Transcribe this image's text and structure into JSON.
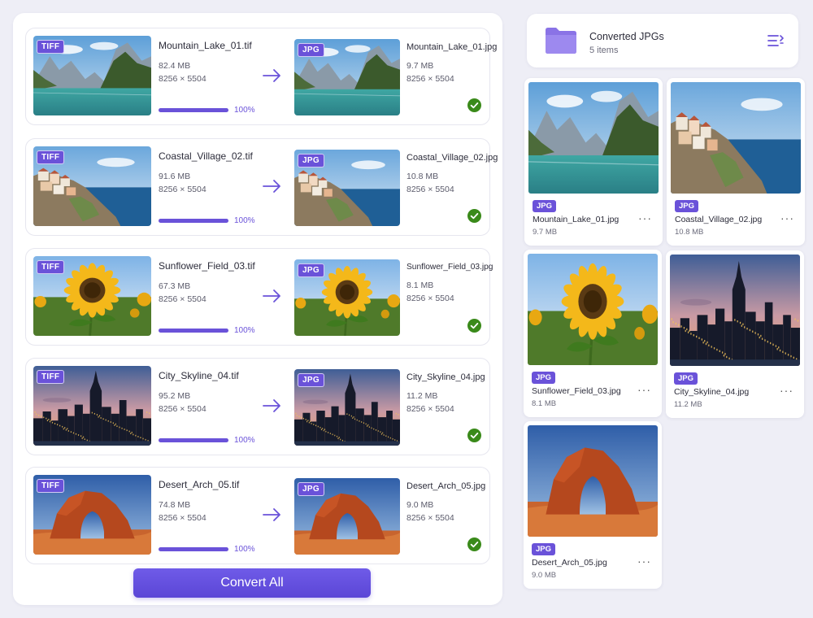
{
  "conversion_list": [
    {
      "src_badge": "TIFF",
      "src_name": "Mountain_Lake_01.tif",
      "src_size": "82.4 MB",
      "src_dims": "8256 × 5504",
      "progress": 100,
      "progress_label": "100%",
      "out_badge": "JPG",
      "out_name": "Mountain_Lake_01.jpg",
      "out_size": "9.7 MB",
      "out_dims": "8256 × 5504",
      "image": "mountain-lake"
    },
    {
      "src_badge": "TIFF",
      "src_name": "Coastal_Village_02.tif",
      "src_size": "91.6 MB",
      "src_dims": "8256 × 5504",
      "progress": 100,
      "progress_label": "100%",
      "out_badge": "JPG",
      "out_name": "Coastal_Village_02.jpg",
      "out_size": "10.8 MB",
      "out_dims": "8256 × 5504",
      "image": "coastal-village"
    },
    {
      "src_badge": "TIFF",
      "src_name": "Sunflower_Field_03.tif",
      "src_size": "67.3 MB",
      "src_dims": "8256 × 5504",
      "progress": 100,
      "progress_label": "100%",
      "out_badge": "JPG",
      "out_name": "Sunflower_Field_03.jpg",
      "out_size": "8.1 MB",
      "out_dims": "8256 × 5504",
      "image": "sunflower"
    },
    {
      "src_badge": "TIFF",
      "src_name": "City_Skyline_04.tif",
      "src_size": "95.2 MB",
      "src_dims": "8256 × 5504",
      "progress": 100,
      "progress_label": "100%",
      "out_badge": "JPG",
      "out_name": "City_Skyline_04.jpg",
      "out_size": "11.2 MB",
      "out_dims": "8256 × 5504",
      "image": "city-skyline"
    },
    {
      "src_badge": "TIFF",
      "src_name": "Desert_Arch_05.tif",
      "src_size": "74.8 MB",
      "src_dims": "8256 × 5504",
      "progress": 100,
      "progress_label": "100%",
      "out_badge": "JPG",
      "out_name": "Desert_Arch_05.jpg",
      "out_size": "9.0 MB",
      "out_dims": "8256 × 5504",
      "image": "desert-arch"
    }
  ],
  "convert_button_label": "Convert All",
  "folder": {
    "title": "Converted JPGs",
    "count": "5 items",
    "icon": "folder-icon",
    "view_icon": "list-view-icon"
  },
  "gallery": [
    {
      "badge": "JPG",
      "name": "Mountain_Lake_01.jpg",
      "size": "9.7 MB",
      "image": "mountain-lake",
      "more": "···"
    },
    {
      "badge": "JPG",
      "name": "Coastal_Village_02.jpg",
      "size": "10.8 MB",
      "image": "coastal-village",
      "more": "···"
    },
    {
      "badge": "JPG",
      "name": "Sunflower_Field_03.jpg",
      "size": "8.1 MB",
      "image": "sunflower",
      "more": "···"
    },
    {
      "badge": "JPG",
      "name": "City_Skyline_04.jpg",
      "size": "11.2 MB",
      "image": "city-skyline",
      "more": "···"
    },
    {
      "badge": "JPG",
      "name": "Desert_Arch_05.jpg",
      "size": "9.0 MB",
      "image": "desert-arch",
      "more": "···"
    }
  ],
  "colors": {
    "accent": "#6a52d9",
    "success": "#3a8a1a",
    "background": "#eeeef6"
  }
}
